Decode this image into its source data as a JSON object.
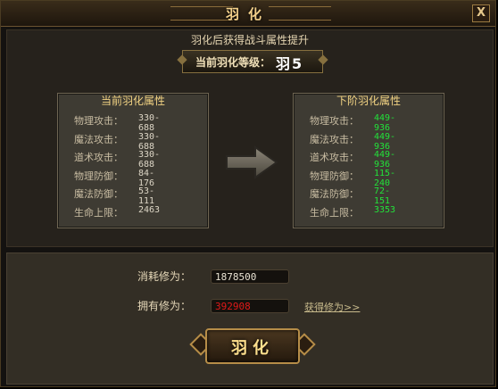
{
  "window": {
    "title": "羽化",
    "close_label": "X"
  },
  "header": {
    "subtitle": "羽化后获得战斗属性提升",
    "level_label": "当前羽化等级：",
    "level_value": "羽5"
  },
  "current": {
    "title": "当前羽化属性",
    "stats": [
      {
        "label": "物理攻击：",
        "value": "330-688"
      },
      {
        "label": "魔法攻击：",
        "value": "330-688"
      },
      {
        "label": "道术攻击：",
        "value": "330-688"
      },
      {
        "label": "物理防御：",
        "value": "84-176"
      },
      {
        "label": "魔法防御：",
        "value": "53-111"
      },
      {
        "label": "生命上限：",
        "value": "2463"
      }
    ]
  },
  "next": {
    "title": "下阶羽化属性",
    "stats": [
      {
        "label": "物理攻击：",
        "value": "449-936"
      },
      {
        "label": "魔法攻击：",
        "value": "449-936"
      },
      {
        "label": "道术攻击：",
        "value": "449-936"
      },
      {
        "label": "物理防御：",
        "value": "115-240"
      },
      {
        "label": "魔法防御：",
        "value": "72-151"
      },
      {
        "label": "生命上限：",
        "value": "3353"
      }
    ]
  },
  "cost": {
    "consume_label": "消耗修为：",
    "consume_value": "1878500",
    "own_label": "拥有修为：",
    "own_value": "392908",
    "get_link": "获得修为>>"
  },
  "action": {
    "button_label": "羽化"
  },
  "colors": {
    "next_value": "#22e23a",
    "insufficient": "#e01919",
    "title_gold": "#f2d383"
  }
}
